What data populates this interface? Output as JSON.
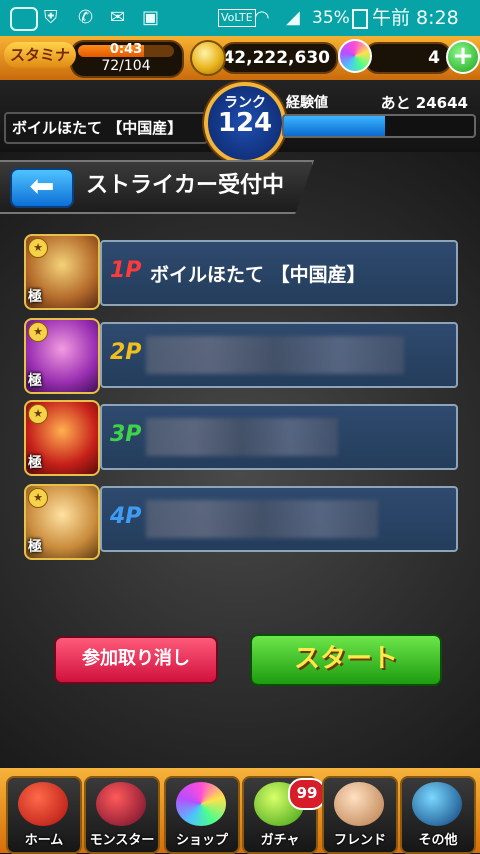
{
  "status_bar": {
    "network": "VoLTE",
    "battery": "35%",
    "time": "午前 8:28"
  },
  "hud": {
    "stamina_label": "スタミナ",
    "stamina_timer": "0:43",
    "stamina_count": "72/104",
    "stamina_fill": 0.69,
    "coins": "42,222,630",
    "orbs": "4",
    "plus_label": "+"
  },
  "player": {
    "name": "ボイルほたて 【中国産】",
    "rank_label": "ランク",
    "rank_value": "124",
    "exp_label": "経験値",
    "exp_remaining": "あと 24644",
    "exp_fill": 0.53
  },
  "header": {
    "back_symbol": "⬅",
    "title": "ストライカー受付中"
  },
  "slots": [
    {
      "player": "1P",
      "name": "ボイルほたて 【中国産】",
      "color": "#ff3a3a",
      "tag": "極"
    },
    {
      "player": "2P",
      "name": "",
      "color": "#f0c01e",
      "tag": "極"
    },
    {
      "player": "3P",
      "name": "",
      "color": "#3fd34a",
      "tag": "極"
    },
    {
      "player": "4P",
      "name": "",
      "color": "#3f9cf5",
      "tag": "極"
    }
  ],
  "buttons": {
    "cancel": "参加取り消し",
    "start": "スタート"
  },
  "nav": {
    "items": [
      {
        "label": "ホーム"
      },
      {
        "label": "モンスター"
      },
      {
        "label": "ショップ"
      },
      {
        "label": "ガチャ"
      },
      {
        "label": "フレンド"
      },
      {
        "label": "その他"
      }
    ],
    "gacha_badge": "99"
  }
}
